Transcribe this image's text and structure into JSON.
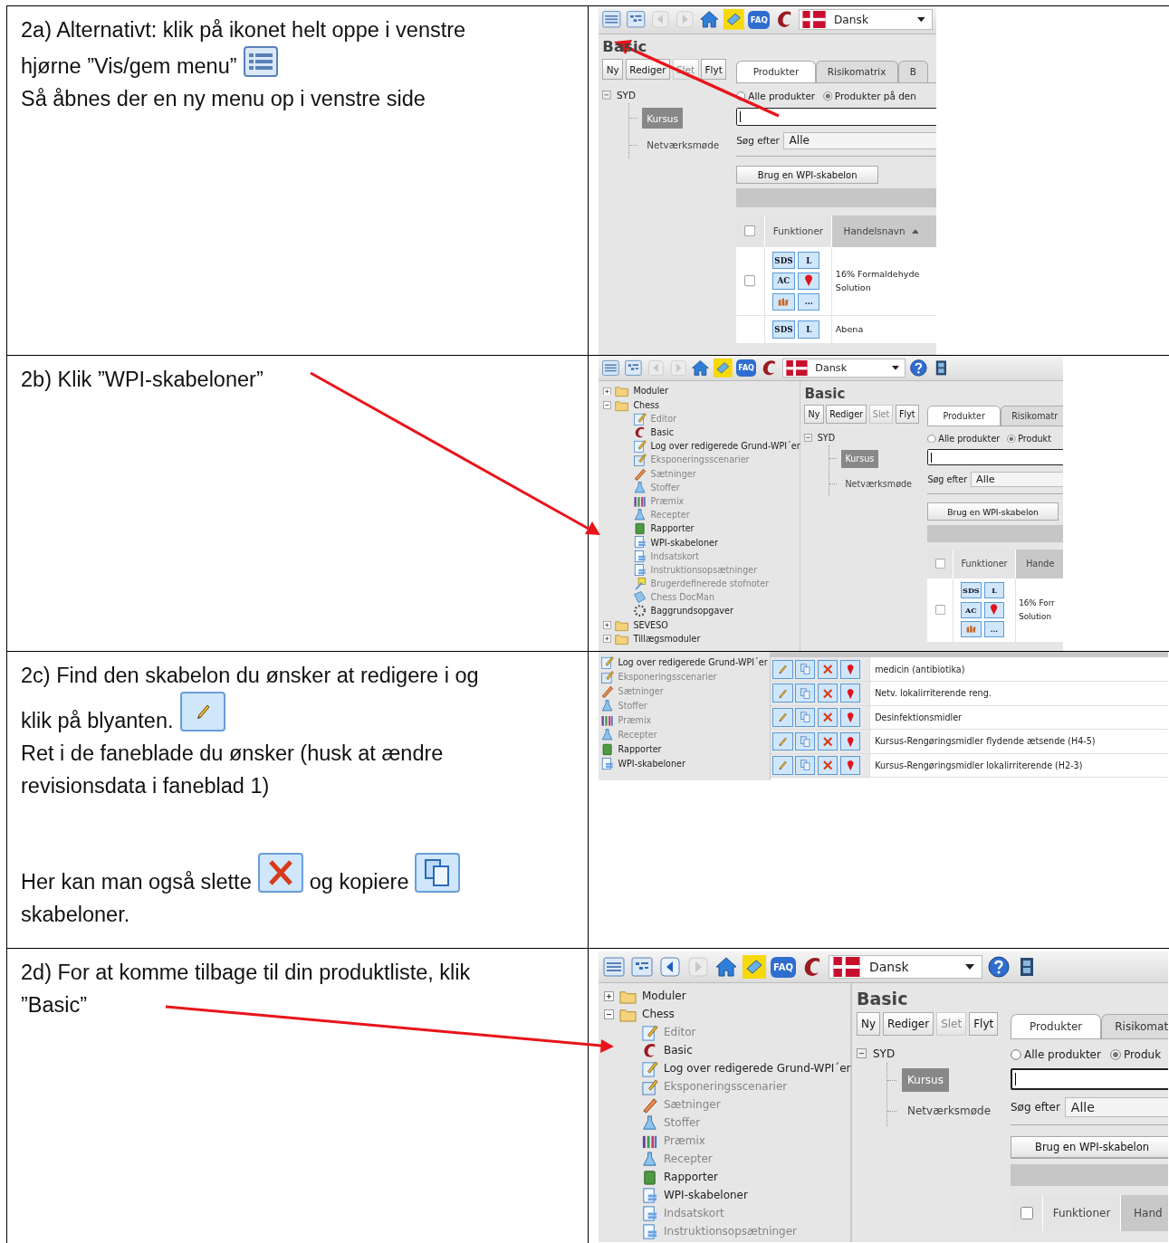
{
  "rows": [
    {
      "instruction": [
        {
          "lines": [
            [
              {
                "kind": "text",
                "text": "2a) Alternativt: klik på ikonet helt oppe i venstre"
              }
            ],
            [
              {
                "kind": "text",
                "text": "hjørne ”Vis/gem menu”"
              },
              {
                "kind": "menu_toggle"
              }
            ],
            [
              {
                "kind": "text",
                "text": "Så åbnes der en ny menu op i venstre side"
              }
            ]
          ]
        }
      ],
      "screenshot": {
        "toolbar": {
          "back_enabled": false,
          "faq": "FAQ",
          "language": "Dansk"
        },
        "main": {
          "title": "Basic",
          "buttons": [
            {
              "label": "Ny",
              "disabled": false
            },
            {
              "label": "Rediger",
              "disabled": false
            },
            {
              "label": "Slet",
              "disabled": true
            },
            {
              "label": "Flyt",
              "disabled": false
            }
          ],
          "tree": [
            {
              "label": "SYD",
              "expanded": true,
              "children": [
                {
                  "label": "Kursus",
                  "selected": true
                },
                {
                  "label": "Netværksmøde",
                  "selected": false
                }
              ]
            }
          ],
          "tabs": [
            {
              "label": "Produkter",
              "selected": true
            },
            {
              "label": "Risikomatrix",
              "selected": false
            },
            {
              "label": "B",
              "selected": false
            }
          ],
          "radios": [
            {
              "label": "Alle produkter",
              "selected": false
            },
            {
              "label": "Produkter på den",
              "selected": true
            }
          ],
          "search_label": "Søg efter",
          "search_select": "Alle",
          "template_button": "Brug en WPI-skabelon",
          "all_checked": false,
          "columns": [
            {
              "label": "Funktioner",
              "sorted": false
            },
            {
              "label": "Handelsnavn",
              "sorted": true
            }
          ],
          "rows": [
            {
              "checked": false,
              "name_lines": [
                "16% Formaldehyde",
                "Solution"
              ],
              "functions": [
                {
                  "kind": "text",
                  "text": "SDS"
                },
                {
                  "kind": "text",
                  "text": "L"
                },
                {
                  "kind": "text",
                  "text": "AC"
                },
                {
                  "kind": "pin"
                },
                {
                  "kind": "hands"
                },
                {
                  "kind": "text",
                  "text": "..."
                }
              ]
            },
            {
              "name_lines": [
                "Abena"
              ],
              "functions": [
                {
                  "kind": "text",
                  "text": "SDS"
                },
                {
                  "kind": "text",
                  "text": "L"
                }
              ]
            }
          ]
        }
      }
    },
    {
      "instruction": [
        {
          "lines": [
            [
              {
                "kind": "text",
                "text": "2b) Klik ”WPI-skabeloner”"
              }
            ]
          ]
        }
      ],
      "screenshot": {
        "toolbar": {
          "back_enabled": false,
          "faq": "FAQ",
          "language": "Dansk"
        },
        "sidebar": [
          {
            "label": "Moduler",
            "kind": "folder",
            "disabled": false,
            "expanded": false
          },
          {
            "label": "Chess",
            "kind": "folder",
            "disabled": false,
            "expanded": true,
            "children": [
              {
                "label": "Editor",
                "kind": "editor",
                "disabled": true
              },
              {
                "label": "Basic",
                "kind": "logo",
                "disabled": false
              },
              {
                "label": "Log over redigerede Grund-WPI´er",
                "kind": "editor",
                "disabled": false
              },
              {
                "label": "Eksponeringsscenarier",
                "kind": "scenarios",
                "disabled": true
              },
              {
                "label": "Sætninger",
                "kind": "phrases",
                "disabled": true
              },
              {
                "label": "Stoffer",
                "kind": "flask",
                "disabled": true
              },
              {
                "label": "Præmix",
                "kind": "tubes",
                "disabled": true
              },
              {
                "label": "Recepter",
                "kind": "flask",
                "disabled": true
              },
              {
                "label": "Rapporter",
                "kind": "report",
                "disabled": false
              },
              {
                "label": "WPI-skabeloner",
                "kind": "document",
                "disabled": false
              },
              {
                "label": "Indsatskort",
                "kind": "document",
                "disabled": true
              },
              {
                "label": "Instruktionsopsætninger",
                "kind": "document",
                "disabled": true
              },
              {
                "label": "Brugerdefinerede stofnoter",
                "kind": "notes",
                "disabled": true
              },
              {
                "label": "Chess DocMan",
                "kind": "docman",
                "disabled": true
              },
              {
                "label": "Baggrundsopgaver",
                "kind": "tasks",
                "disabled": false
              }
            ]
          },
          {
            "label": "SEVESO",
            "kind": "folder",
            "disabled": false,
            "expanded": false
          },
          {
            "label": "Tillægsmoduler",
            "kind": "folder",
            "disabled": false,
            "expanded": false
          }
        ],
        "main": {
          "title": "Basic",
          "buttons": [
            {
              "label": "Ny",
              "disabled": false
            },
            {
              "label": "Rediger",
              "disabled": false
            },
            {
              "label": "Slet",
              "disabled": true
            },
            {
              "label": "Flyt",
              "disabled": false
            }
          ],
          "tree": [
            {
              "label": "SYD",
              "expanded": true,
              "children": [
                {
                  "label": "Kursus",
                  "selected": true
                },
                {
                  "label": "Netværksmøde",
                  "selected": false
                }
              ]
            }
          ],
          "tabs": [
            {
              "label": "Produkter",
              "selected": true
            },
            {
              "label": "Risikomatr",
              "selected": false
            }
          ],
          "radios": [
            {
              "label": "Alle produkter",
              "selected": false
            },
            {
              "label": "Produkt",
              "selected": true
            }
          ],
          "search_label": "Søg efter",
          "search_select": "Alle",
          "template_button": "Brug en WPI-skabelon",
          "all_checked": false,
          "columns": [
            {
              "label": "Funktioner"
            },
            {
              "label": "Hande"
            }
          ],
          "rows": [
            {
              "checked": false,
              "name_lines": [
                "16% Forr",
                "Solution"
              ],
              "functions": [
                {
                  "kind": "text",
                  "text": "SDS"
                },
                {
                  "kind": "text",
                  "text": "L"
                },
                {
                  "kind": "text",
                  "text": "AC"
                },
                {
                  "kind": "pin"
                },
                {
                  "kind": "hands"
                },
                {
                  "kind": "text",
                  "text": "..."
                }
              ]
            }
          ]
        }
      }
    },
    {
      "instruction": [
        {
          "lines": [
            [
              {
                "kind": "text",
                "text": "2c) Find den skabelon du ønsker at redigere i og"
              }
            ],
            [
              {
                "kind": "text",
                "text": "klik på blyanten."
              },
              {
                "kind": "edit_button"
              }
            ],
            [
              {
                "kind": "text",
                "text": "Ret i de faneblade du ønsker (husk at ændre"
              }
            ],
            [
              {
                "kind": "text",
                "text": "revisionsdata i faneblad 1)"
              }
            ]
          ]
        },
        {
          "lines": [
            [
              {
                "kind": "text",
                "text": "Her kan man også slette"
              },
              {
                "kind": "delete_button"
              },
              {
                "kind": "text",
                "text": "og kopiere"
              },
              {
                "kind": "copy_button"
              }
            ],
            [
              {
                "kind": "text",
                "text": "skabeloner."
              }
            ]
          ]
        }
      ],
      "screenshot": {
        "sidebar": [
          {
            "label": "Log over redigerede Grund-WPI´er",
            "kind": "editor",
            "disabled": false
          },
          {
            "label": "Eksponeringsscenarier",
            "kind": "scenarios",
            "disabled": true
          },
          {
            "label": "Sætninger",
            "kind": "phrases",
            "disabled": true
          },
          {
            "label": "Stoffer",
            "kind": "flask",
            "disabled": true
          },
          {
            "label": "Præmix",
            "kind": "tubes",
            "disabled": true
          },
          {
            "label": "Recepter",
            "kind": "flask",
            "disabled": true
          },
          {
            "label": "Rapporter",
            "kind": "report",
            "disabled": false
          },
          {
            "label": "WPI-skabeloner",
            "kind": "document",
            "disabled": false
          }
        ],
        "template_table": {
          "rows": [
            {
              "name": "medicin (antibiotika)"
            },
            {
              "name": "Netv. lokalirriterende  reng."
            },
            {
              "name": "Desinfektionsmidler"
            },
            {
              "name": "Kursus-Rengøringsmidler flydende ætsende (H4-5)"
            },
            {
              "name": "Kursus-Rengøringsmidler lokalirriterende (H2-3)"
            }
          ]
        }
      }
    },
    {
      "instruction": [
        {
          "lines": [
            [
              {
                "kind": "text",
                "text": "2d) For at komme tilbage til din produktliste, klik"
              }
            ],
            [
              {
                "kind": "text",
                "text": "”Basic”"
              }
            ]
          ]
        }
      ],
      "screenshot": {
        "toolbar": {
          "back_enabled": true,
          "faq": "FAQ",
          "language": "Dansk"
        },
        "sidebar": [
          {
            "label": "Moduler",
            "kind": "folder",
            "disabled": false,
            "expanded": false
          },
          {
            "label": "Chess",
            "kind": "folder",
            "disabled": false,
            "expanded": true,
            "children": [
              {
                "label": "Editor",
                "kind": "editor",
                "disabled": true
              },
              {
                "label": "Basic",
                "kind": "logo",
                "disabled": false
              },
              {
                "label": "Log over redigerede Grund-WPI´er",
                "kind": "editor",
                "disabled": false
              },
              {
                "label": "Eksponeringsscenarier",
                "kind": "scenarios",
                "disabled": true
              },
              {
                "label": "Sætninger",
                "kind": "phrases",
                "disabled": true
              },
              {
                "label": "Stoffer",
                "kind": "flask",
                "disabled": true
              },
              {
                "label": "Præmix",
                "kind": "tubes",
                "disabled": true
              },
              {
                "label": "Recepter",
                "kind": "flask",
                "disabled": true
              },
              {
                "label": "Rapporter",
                "kind": "report",
                "disabled": false
              },
              {
                "label": "WPI-skabeloner",
                "kind": "document",
                "disabled": false
              },
              {
                "label": "Indsatskort",
                "kind": "document",
                "disabled": true
              },
              {
                "label": "Instruktionsopsætninger",
                "kind": "document",
                "disabled": true
              }
            ]
          }
        ],
        "main": {
          "title": "Basic",
          "buttons": [
            {
              "label": "Ny",
              "disabled": false
            },
            {
              "label": "Rediger",
              "disabled": false
            },
            {
              "label": "Slet",
              "disabled": true
            },
            {
              "label": "Flyt",
              "disabled": false
            }
          ],
          "tree": [
            {
              "label": "SYD",
              "expanded": true,
              "children": [
                {
                  "label": "Kursus",
                  "selected": true
                },
                {
                  "label": "Netværksmøde",
                  "selected": false
                }
              ]
            }
          ],
          "tabs": [
            {
              "label": "Produkter",
              "selected": true
            },
            {
              "label": "Risikomat",
              "selected": false
            }
          ],
          "radios": [
            {
              "label": "Alle produkter",
              "selected": false
            },
            {
              "label": "Produk",
              "selected": true
            }
          ],
          "search_label": "Søg efter",
          "search_select": "Alle",
          "template_button": "Brug en WPI-skabelon",
          "all_checked": false,
          "columns": [
            {
              "label": "Funktioner"
            },
            {
              "label": "Hand"
            }
          ]
        }
      }
    }
  ]
}
